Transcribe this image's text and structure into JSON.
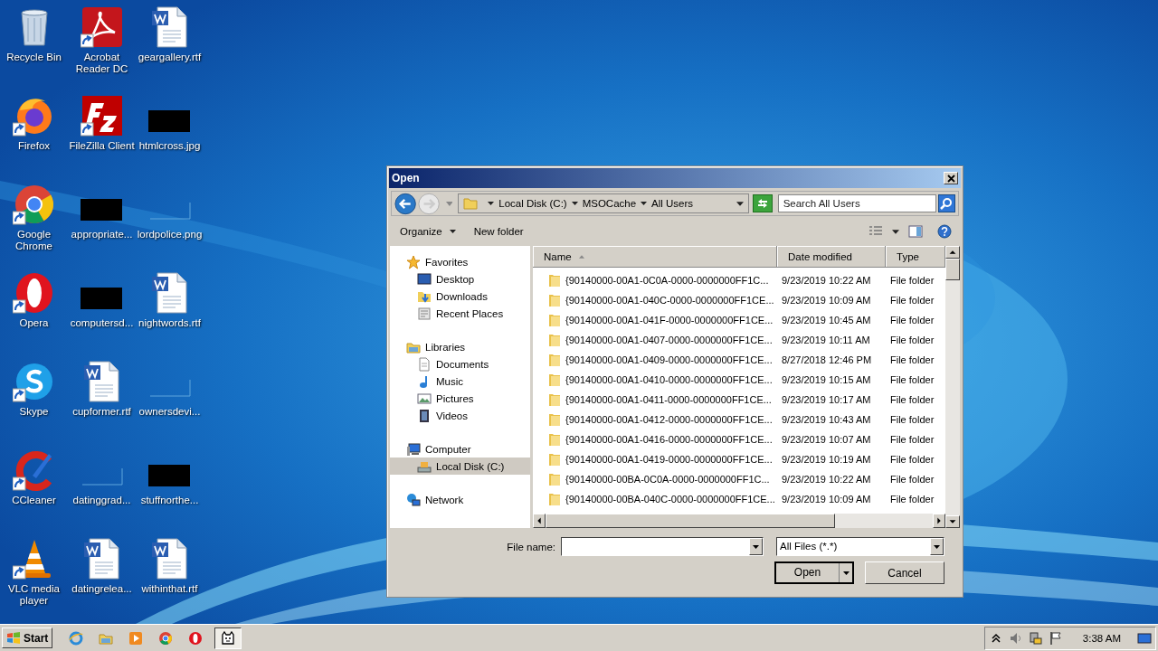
{
  "desktop_icons": [
    {
      "label": "Recycle Bin",
      "kind": "recycle",
      "shortcut": false
    },
    {
      "label": "Acrobat Reader DC",
      "kind": "acrobat",
      "shortcut": true
    },
    {
      "label": "geargallery.rtf",
      "kind": "word",
      "shortcut": false
    },
    {
      "label": "Firefox",
      "kind": "firefox",
      "shortcut": true
    },
    {
      "label": "FileZilla Client",
      "kind": "filezilla",
      "shortcut": true
    },
    {
      "label": "htmlcross.jpg",
      "kind": "redacted",
      "shortcut": false
    },
    {
      "label": "Google Chrome",
      "kind": "chrome",
      "shortcut": true
    },
    {
      "label": "appropriate...",
      "kind": "redacted",
      "shortcut": false
    },
    {
      "label": "lordpolice.png",
      "kind": "blank",
      "shortcut": false
    },
    {
      "label": "Opera",
      "kind": "opera",
      "shortcut": true
    },
    {
      "label": "computersd...",
      "kind": "redacted",
      "shortcut": false
    },
    {
      "label": "nightwords.rtf",
      "kind": "word",
      "shortcut": false
    },
    {
      "label": "Skype",
      "kind": "skype",
      "shortcut": true
    },
    {
      "label": "cupformer.rtf",
      "kind": "word",
      "shortcut": false
    },
    {
      "label": "ownersdevi...",
      "kind": "blank",
      "shortcut": false
    },
    {
      "label": "CCleaner",
      "kind": "ccleaner",
      "shortcut": true
    },
    {
      "label": "datinggrad...",
      "kind": "blank",
      "shortcut": false
    },
    {
      "label": "stuffnorthe...",
      "kind": "redacted",
      "shortcut": false
    },
    {
      "label": "VLC media player",
      "kind": "vlc",
      "shortcut": true
    },
    {
      "label": "datingrelea...",
      "kind": "word",
      "shortcut": false
    },
    {
      "label": "withinthat.rtf",
      "kind": "word",
      "shortcut": false
    }
  ],
  "dialog": {
    "title": "Open",
    "address": [
      "Local Disk (C:)",
      "MSOCache",
      "All Users"
    ],
    "search": {
      "placeholder": "Search All Users"
    },
    "toolbar": [
      "Organize",
      "New folder"
    ],
    "nav": [
      {
        "label": "Favorites",
        "kind": "star",
        "selected": false,
        "children": [
          {
            "label": "Desktop",
            "kind": "desktop",
            "selected": false
          },
          {
            "label": "Downloads",
            "kind": "downloads",
            "selected": false
          },
          {
            "label": "Recent Places",
            "kind": "recent",
            "selected": false
          }
        ]
      },
      {
        "label": "Libraries",
        "kind": "library",
        "selected": false,
        "children": [
          {
            "label": "Documents",
            "kind": "document",
            "selected": false
          },
          {
            "label": "Music",
            "kind": "music",
            "selected": false
          },
          {
            "label": "Pictures",
            "kind": "pictures",
            "selected": false
          },
          {
            "label": "Videos",
            "kind": "videos",
            "selected": false
          }
        ]
      },
      {
        "label": "Computer",
        "kind": "computer",
        "selected": false,
        "children": [
          {
            "label": "Local Disk (C:)",
            "kind": "disk",
            "selected": true
          }
        ]
      },
      {
        "label": "Network",
        "kind": "network",
        "selected": false
      }
    ],
    "columns": [
      {
        "label": "Name",
        "sorted": true
      },
      {
        "label": "Date modified",
        "sorted": false
      },
      {
        "label": "Type",
        "sorted": false
      }
    ],
    "rows": [
      {
        "name": "{90140000-00A1-0C0A-0000-0000000FF1C...",
        "date": "9/23/2019 10:22 AM",
        "type": "File folder"
      },
      {
        "name": "{90140000-00A1-040C-0000-0000000FF1CE...",
        "date": "9/23/2019 10:09 AM",
        "type": "File folder"
      },
      {
        "name": "{90140000-00A1-041F-0000-0000000FF1CE...",
        "date": "9/23/2019 10:45 AM",
        "type": "File folder"
      },
      {
        "name": "{90140000-00A1-0407-0000-0000000FF1CE...",
        "date": "9/23/2019 10:11 AM",
        "type": "File folder"
      },
      {
        "name": "{90140000-00A1-0409-0000-0000000FF1CE...",
        "date": "8/27/2018 12:46 PM",
        "type": "File folder"
      },
      {
        "name": "{90140000-00A1-0410-0000-0000000FF1CE...",
        "date": "9/23/2019 10:15 AM",
        "type": "File folder"
      },
      {
        "name": "{90140000-00A1-0411-0000-0000000FF1CE...",
        "date": "9/23/2019 10:17 AM",
        "type": "File folder"
      },
      {
        "name": "{90140000-00A1-0412-0000-0000000FF1CE...",
        "date": "9/23/2019 10:43 AM",
        "type": "File folder"
      },
      {
        "name": "{90140000-00A1-0416-0000-0000000FF1CE...",
        "date": "9/23/2019 10:07 AM",
        "type": "File folder"
      },
      {
        "name": "{90140000-00A1-0419-0000-0000000FF1CE...",
        "date": "9/23/2019 10:19 AM",
        "type": "File folder"
      },
      {
        "name": "{90140000-00BA-0C0A-0000-0000000FF1C...",
        "date": "9/23/2019 10:22 AM",
        "type": "File folder"
      },
      {
        "name": "{90140000-00BA-040C-0000-0000000FF1CE...",
        "date": "9/23/2019 10:09 AM",
        "type": "File folder"
      }
    ],
    "file_name_label": "File name:",
    "filter": "All Files (*.*)",
    "buttons": [
      "Open",
      "Cancel"
    ]
  },
  "taskbar": {
    "start": "Start",
    "items": [
      {
        "kind": "ie",
        "active": false
      },
      {
        "kind": "explorer",
        "active": false
      },
      {
        "kind": "media",
        "active": false
      },
      {
        "kind": "chrome",
        "active": false
      },
      {
        "kind": "opera",
        "active": false
      },
      {
        "kind": "catapp",
        "active": true
      }
    ],
    "tray": [
      {
        "kind": "up"
      },
      {
        "kind": "volume"
      },
      {
        "kind": "network"
      },
      {
        "kind": "flag"
      }
    ],
    "clock": "3:38 AM"
  }
}
